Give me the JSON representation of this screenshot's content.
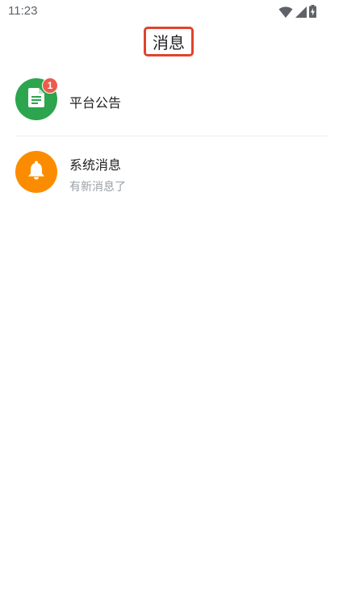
{
  "status_bar": {
    "time": "11:23",
    "icons": [
      "wifi-icon",
      "signal-icon",
      "battery-charging-icon"
    ]
  },
  "header": {
    "title": "消息",
    "highlight_color": "#e0432e"
  },
  "messages": [
    {
      "title": "平台公告",
      "subtitle": "",
      "badge": "1",
      "icon": "document-icon",
      "color": "#2da44e"
    },
    {
      "title": "系统消息",
      "subtitle": "有新消息了",
      "badge": "",
      "icon": "bell-icon",
      "color": "#fb8c00"
    }
  ]
}
